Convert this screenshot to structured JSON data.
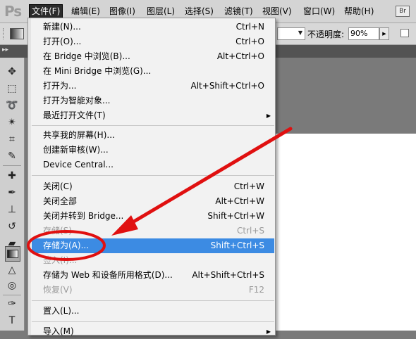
{
  "app": {
    "logo": "Ps",
    "bridge_badge": "Br"
  },
  "menubar": {
    "items": [
      "文件(F)",
      "编辑(E)",
      "图像(I)",
      "图层(L)",
      "选择(S)",
      "滤镜(T)",
      "视图(V)",
      "窗口(W)",
      "帮助(H)"
    ],
    "active_index": 0
  },
  "options_bar": {
    "opacity_label": "不透明度:",
    "opacity_value": "90%"
  },
  "file_menu": {
    "items": [
      {
        "label": "新建(N)...",
        "shortcut": "Ctrl+N"
      },
      {
        "label": "打开(O)...",
        "shortcut": "Ctrl+O"
      },
      {
        "label": "在 Bridge 中浏览(B)...",
        "shortcut": "Alt+Ctrl+O"
      },
      {
        "label": "在 Mini Bridge 中浏览(G)...",
        "shortcut": ""
      },
      {
        "label": "打开为...",
        "shortcut": "Alt+Shift+Ctrl+O"
      },
      {
        "label": "打开为智能对象...",
        "shortcut": ""
      },
      {
        "label": "最近打开文件(T)",
        "shortcut": "",
        "submenu": true
      },
      {
        "label": "共享我的屏幕(H)...",
        "shortcut": ""
      },
      {
        "label": "创建新审核(W)...",
        "shortcut": ""
      },
      {
        "label": "Device Central...",
        "shortcut": ""
      },
      {
        "label": "关闭(C)",
        "shortcut": "Ctrl+W"
      },
      {
        "label": "关闭全部",
        "shortcut": "Alt+Ctrl+W"
      },
      {
        "label": "关闭并转到 Bridge...",
        "shortcut": "Shift+Ctrl+W"
      },
      {
        "label": "存储(S)",
        "shortcut": "Ctrl+S",
        "disabled": true
      },
      {
        "label": "存储为(A)...",
        "shortcut": "Shift+Ctrl+S",
        "highlighted": true
      },
      {
        "label": "签入(I)...",
        "shortcut": "",
        "disabled": true
      },
      {
        "label": "存储为 Web 和设备所用格式(D)...",
        "shortcut": "Alt+Shift+Ctrl+S"
      },
      {
        "label": "恢复(V)",
        "shortcut": "F12",
        "disabled": true
      },
      {
        "label": "置入(L)...",
        "shortcut": ""
      },
      {
        "label": "导入(M)",
        "shortcut": "",
        "submenu": true
      }
    ]
  },
  "tools": [
    "move-icon",
    "marquee-icon",
    "lasso-icon",
    "magic-wand-icon",
    "crop-icon",
    "eyedropper-icon",
    "healing-brush-icon",
    "brush-icon",
    "clone-stamp-icon",
    "history-brush-icon",
    "eraser-icon",
    "gradient-icon",
    "blur-icon",
    "dodge-icon",
    "pen-icon",
    "type-icon"
  ],
  "colors": {
    "highlight": "#3c8be3",
    "annotation": "#e01010"
  }
}
